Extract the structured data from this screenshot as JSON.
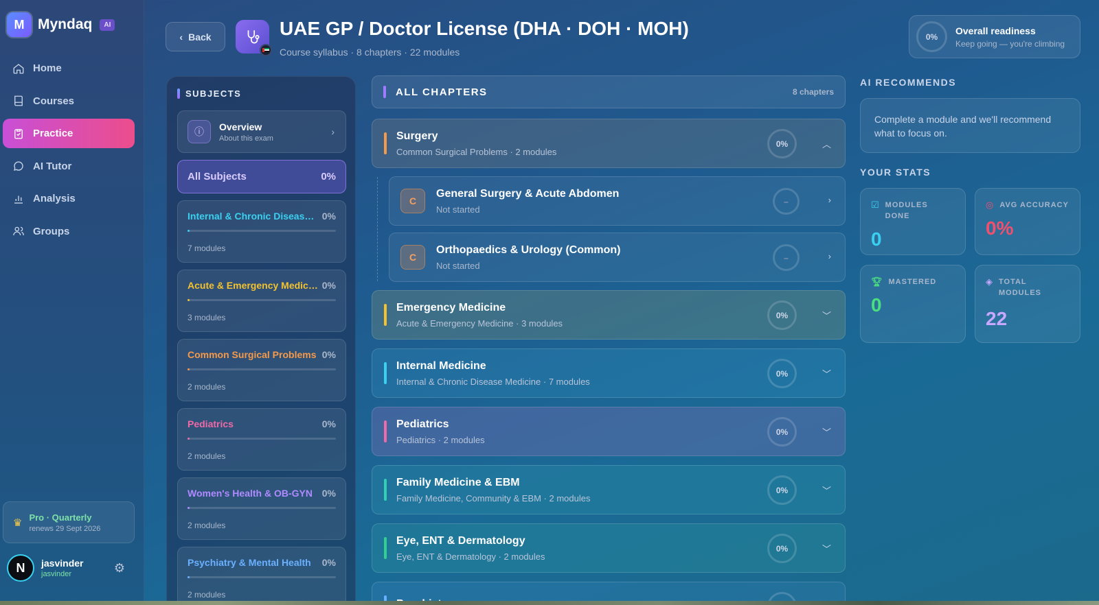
{
  "brand": {
    "name": "Myndaq",
    "badge": "AI",
    "logo_letter": "M"
  },
  "nav": [
    {
      "label": "Home",
      "icon": "home-icon"
    },
    {
      "label": "Courses",
      "icon": "book-icon"
    },
    {
      "label": "Practice",
      "icon": "clipboard-icon",
      "active": true
    },
    {
      "label": "AI Tutor",
      "icon": "chat-icon"
    },
    {
      "label": "Analysis",
      "icon": "bar-chart-icon"
    },
    {
      "label": "Groups",
      "icon": "users-icon"
    }
  ],
  "plan": {
    "title": "Pro · Quarterly",
    "renews": "renews 29 Sept 2026"
  },
  "user": {
    "name": "jasvinder",
    "handle": "jasvinder",
    "avatar_letter": "N"
  },
  "header": {
    "back_label": "Back",
    "title": "UAE GP / Doctor License (DHA · DOH · MOH)",
    "subtitle": "Course syllabus · 8 chapters · 22 modules"
  },
  "readiness": {
    "percent": "0%",
    "title": "Overall readiness",
    "subtitle": "Keep going — you're climbing"
  },
  "subjects": {
    "heading": "SUBJECTS",
    "overview": {
      "title": "Overview",
      "subtitle": "About this exam"
    },
    "all": {
      "label": "All Subjects",
      "percent": "0%"
    },
    "items": [
      {
        "name": "Internal & Chronic Disease Medicine",
        "percent": "0%",
        "modules": "7 modules",
        "color": "#3ad0f0"
      },
      {
        "name": "Acute & Emergency Medicine",
        "percent": "0%",
        "modules": "3 modules",
        "color": "#f2c230"
      },
      {
        "name": "Common Surgical Problems",
        "percent": "0%",
        "modules": "2 modules",
        "color": "#f59a4a"
      },
      {
        "name": "Pediatrics",
        "percent": "0%",
        "modules": "2 modules",
        "color": "#f06aa8"
      },
      {
        "name": "Women's Health & OB-GYN",
        "percent": "0%",
        "modules": "2 modules",
        "color": "#b08aff"
      },
      {
        "name": "Psychiatry & Mental Health",
        "percent": "0%",
        "modules": "2 modules",
        "color": "#6ab0ff"
      }
    ]
  },
  "chapters": {
    "heading": "ALL CHAPTERS",
    "count": "8 chapters",
    "items": [
      {
        "title": "Surgery",
        "subtitle": "Common Surgical Problems · 2 modules",
        "percent": "0%",
        "color": "#f59a4a",
        "bg": "rgba(190,150,110,0.18)",
        "expanded": true
      },
      {
        "title": "Emergency Medicine",
        "subtitle": "Acute & Emergency Medicine · 3 modules",
        "percent": "0%",
        "color": "#f2c230",
        "bg": "rgba(190,180,100,0.2)"
      },
      {
        "title": "Internal Medicine",
        "subtitle": "Internal & Chronic Disease Medicine · 7 modules",
        "percent": "0%",
        "color": "#3ad0f0",
        "bg": "rgba(60,170,220,0.18)"
      },
      {
        "title": "Pediatrics",
        "subtitle": "Pediatrics · 2 modules",
        "percent": "0%",
        "color": "#f06aa8",
        "bg": "rgba(170,110,190,0.25)"
      },
      {
        "title": "Family Medicine & EBM",
        "subtitle": "Family Medicine, Community & EBM · 2 modules",
        "percent": "0%",
        "color": "#30d0b0",
        "bg": "rgba(60,190,190,0.16)"
      },
      {
        "title": "Eye, ENT & Dermatology",
        "subtitle": "Eye, ENT & Dermatology · 2 modules",
        "percent": "0%",
        "color": "#30d090",
        "bg": "rgba(60,190,170,0.16)"
      },
      {
        "title": "Psychiatry",
        "subtitle": "",
        "percent": "",
        "color": "#6ab0ff",
        "bg": "rgba(80,150,220,0.16)"
      }
    ],
    "modules": [
      {
        "badge": "C",
        "title": "General Surgery & Acute Abdomen",
        "status": "Not started",
        "progress": "–"
      },
      {
        "badge": "C",
        "title": "Orthopaedics & Urology (Common)",
        "status": "Not started",
        "progress": "–"
      }
    ]
  },
  "ai_recommends": {
    "heading": "AI RECOMMENDS",
    "text": "Complete a module and we'll recommend what to focus on."
  },
  "stats": {
    "heading": "YOUR STATS",
    "modules_done": {
      "label": "MODULES DONE",
      "value": "0",
      "color": "#3ad0f0",
      "icon": "check-square-icon"
    },
    "avg_accuracy": {
      "label": "AVG ACCURACY",
      "value": "0%",
      "color": "#f0506e",
      "icon": "target-icon"
    },
    "mastered": {
      "label": "MASTERED",
      "value": "0",
      "color": "#4ade80",
      "icon": "trophy-icon"
    },
    "total_modules": {
      "label": "TOTAL MODULES",
      "value": "22",
      "color": "#c8a8ff",
      "icon": "layers-icon"
    }
  }
}
